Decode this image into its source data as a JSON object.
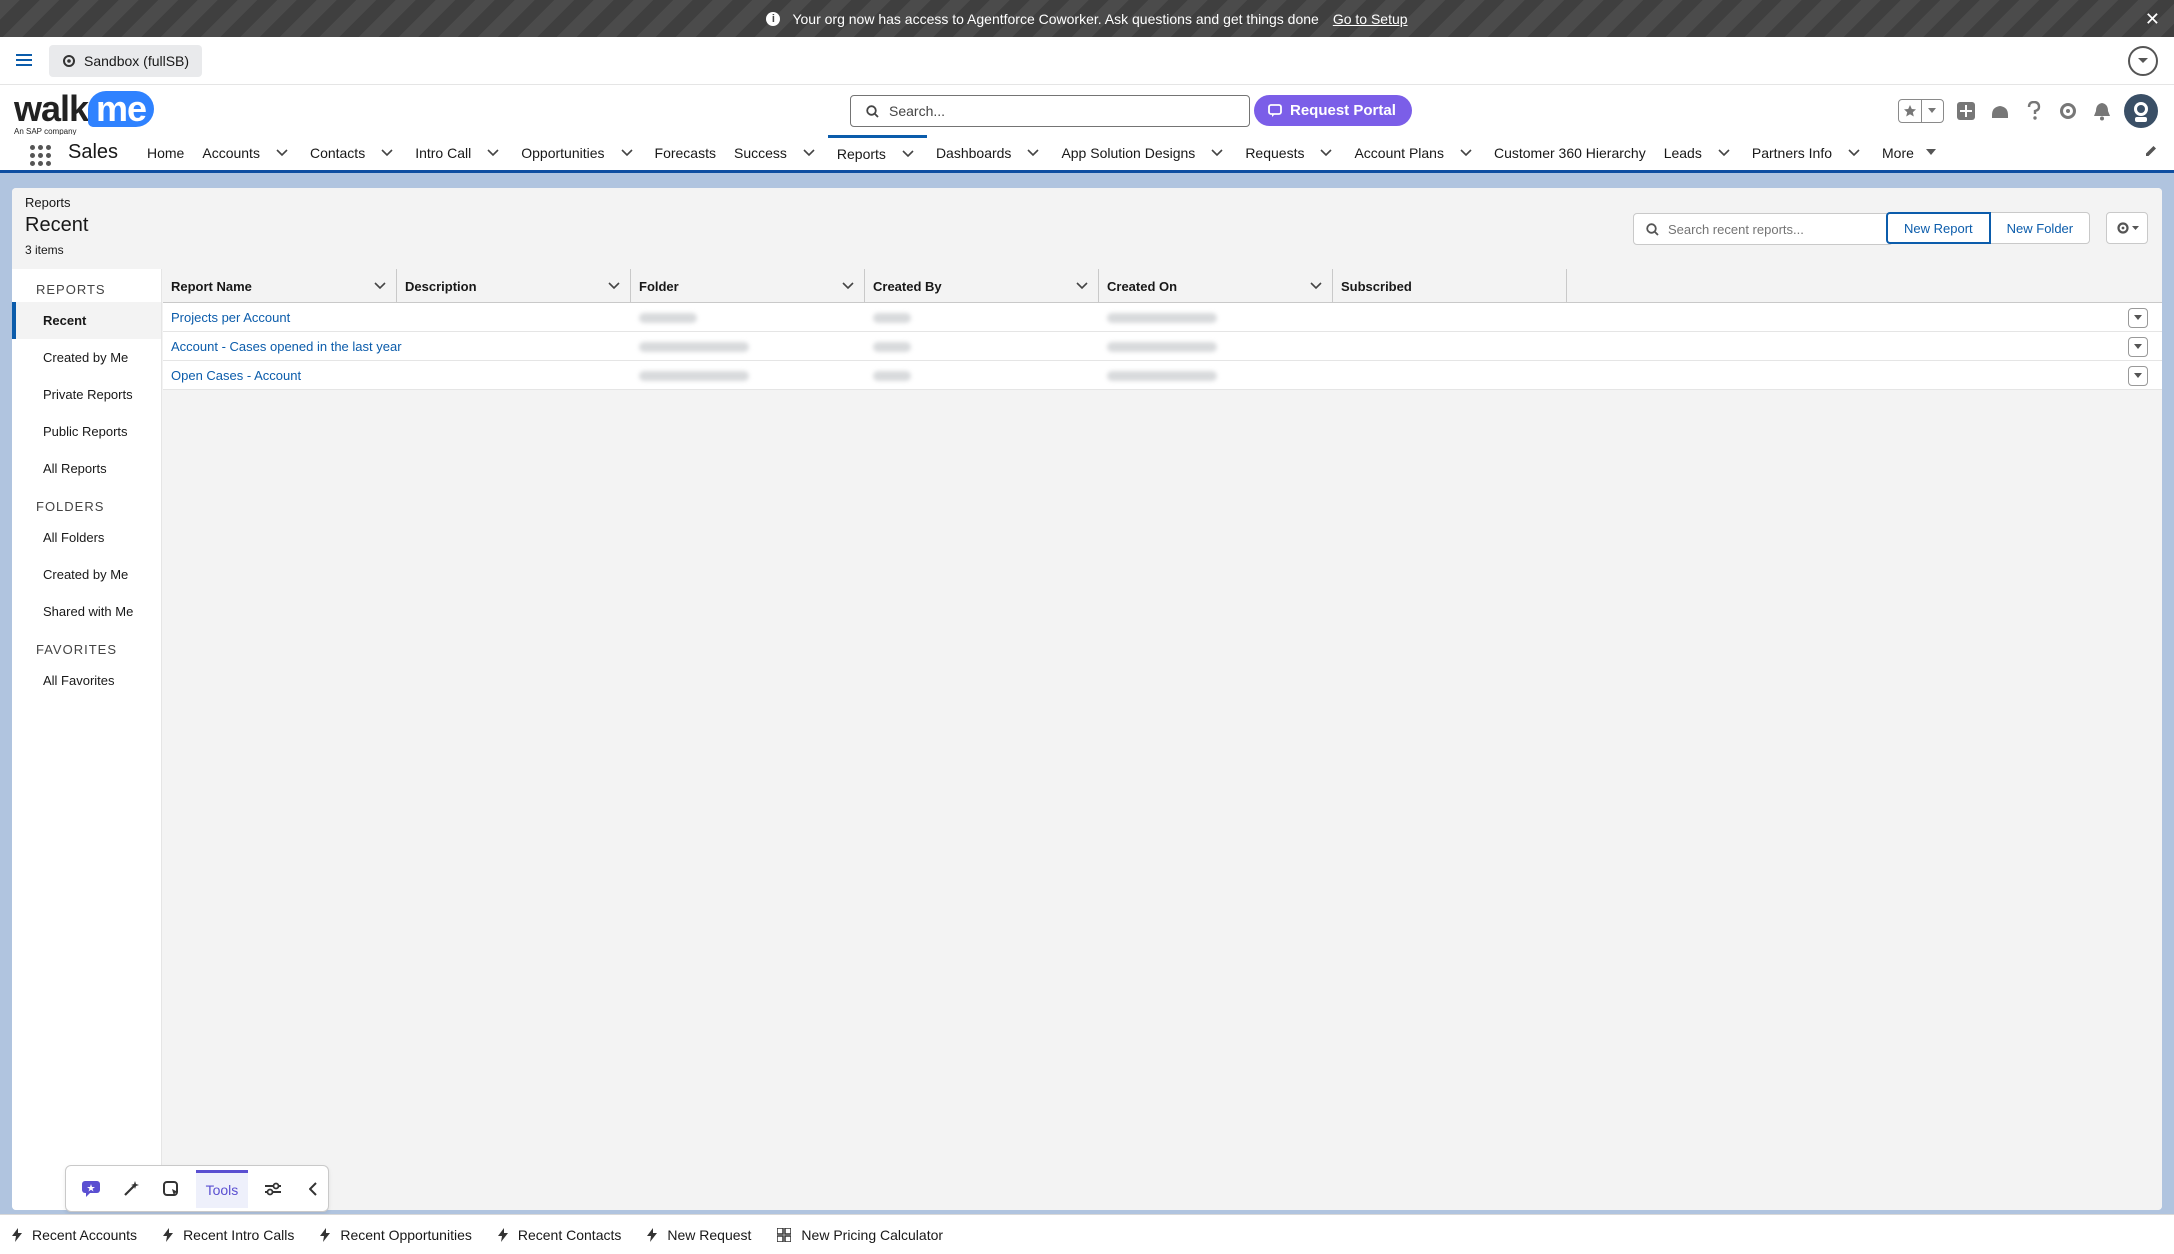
{
  "banner": {
    "message": "Your org now has access to Agentforce Coworker. Ask questions and get things done",
    "link": "Go to Setup"
  },
  "sandbox": {
    "label": "Sandbox (fullSB)"
  },
  "header": {
    "logo_main": "walk",
    "logo_me": "me",
    "logo_sub": "An SAP company",
    "search_placeholder": "Search...",
    "portal_button": "Request Portal"
  },
  "nav": {
    "app_name": "Sales",
    "items": [
      {
        "label": "Home",
        "dropdown": false
      },
      {
        "label": "Accounts",
        "dropdown": true
      },
      {
        "label": "Contacts",
        "dropdown": true
      },
      {
        "label": "Intro Call",
        "dropdown": true
      },
      {
        "label": "Opportunities",
        "dropdown": true
      },
      {
        "label": "Forecasts",
        "dropdown": false
      },
      {
        "label": "Success",
        "dropdown": true
      },
      {
        "label": "Reports",
        "dropdown": true,
        "active": true
      },
      {
        "label": "Dashboards",
        "dropdown": true
      },
      {
        "label": "App Solution Designs",
        "dropdown": true
      },
      {
        "label": "Requests",
        "dropdown": true
      },
      {
        "label": "Account Plans",
        "dropdown": true
      },
      {
        "label": "Customer 360 Hierarchy",
        "dropdown": false
      },
      {
        "label": "Leads",
        "dropdown": true
      },
      {
        "label": "Partners Info",
        "dropdown": true
      }
    ],
    "more": "More"
  },
  "page": {
    "breadcrumb": "Reports",
    "title": "Recent",
    "count": "3 items",
    "search_placeholder": "Search recent reports...",
    "new_report": "New Report",
    "new_folder": "New Folder"
  },
  "sidebar": {
    "reports_heading": "REPORTS",
    "reports": [
      "Recent",
      "Created by Me",
      "Private Reports",
      "Public Reports",
      "All Reports"
    ],
    "folders_heading": "FOLDERS",
    "folders": [
      "All Folders",
      "Created by Me",
      "Shared with Me"
    ],
    "favorites_heading": "FAVORITES",
    "favorites": [
      "All Favorites"
    ]
  },
  "table": {
    "columns": [
      "Report Name",
      "Description",
      "Folder",
      "Created By",
      "Created On",
      "Subscribed"
    ],
    "rows": [
      {
        "name": "Projects per Account",
        "description": ""
      },
      {
        "name": "Account - Cases opened in the last year",
        "description": ""
      },
      {
        "name": "Open Cases - Account",
        "description": ""
      }
    ]
  },
  "tools": {
    "label": "Tools"
  },
  "utility_bar": {
    "items": [
      {
        "label": "Recent Accounts",
        "icon": "bolt-icon"
      },
      {
        "label": "Recent Intro Calls",
        "icon": "bolt-icon"
      },
      {
        "label": "Recent Opportunities",
        "icon": "bolt-icon"
      },
      {
        "label": "Recent Contacts",
        "icon": "bolt-icon"
      },
      {
        "label": "New Request",
        "icon": "bolt-icon"
      },
      {
        "label": "New Pricing Calculator",
        "icon": "grid-icon"
      }
    ]
  },
  "colors": {
    "brand_blue": "#0b5cab",
    "portal_purple": "#7b5ee8",
    "page_bg": "#b0c4df"
  }
}
